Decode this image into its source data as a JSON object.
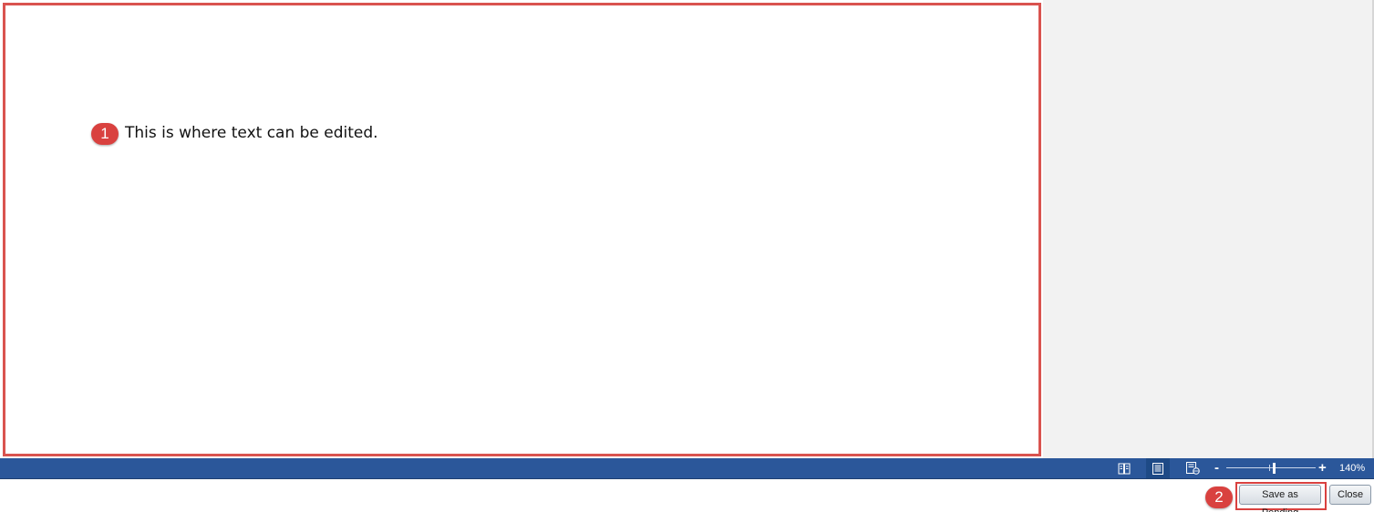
{
  "editor": {
    "body_text": "This is where text can be edited."
  },
  "callouts": {
    "editor_marker": "1",
    "save_marker": "2"
  },
  "status_bar": {
    "view_icons": [
      "read-mode-icon",
      "print-layout-icon",
      "web-layout-icon"
    ],
    "active_view": "print-layout-icon",
    "zoom_minus": "-",
    "zoom_plus": "+",
    "zoom_level": "140%",
    "background_color": "#2b579a"
  },
  "actions": {
    "save_label": "Save as Pending",
    "close_label": "Close"
  },
  "colors": {
    "highlight": "#d9534f",
    "callout": "#d9413f"
  }
}
